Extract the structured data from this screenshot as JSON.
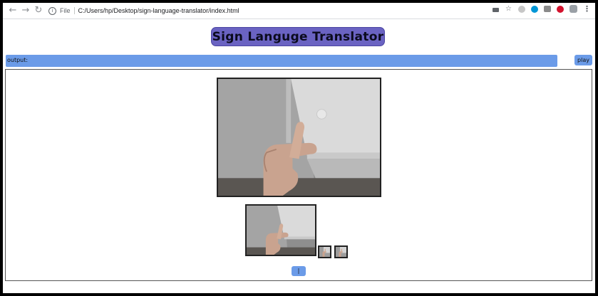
{
  "browser": {
    "file_label": "File",
    "url": "C:/Users/hp/Desktop/sign-language-translator/index.html"
  },
  "page": {
    "title": "Sign Languge Translator",
    "output_label": "output:",
    "play_label": "play",
    "capture_label": "|"
  },
  "icons": {
    "back": "back-arrow-icon",
    "forward": "forward-arrow-icon",
    "reload": "reload-icon",
    "info": "info-icon",
    "camera": "camera-icon",
    "star": "bookmark-star-icon",
    "menu": "menu-kebab-icon"
  },
  "colors": {
    "title_bg": "#6a63c2",
    "button_bg": "#6b9be8"
  }
}
